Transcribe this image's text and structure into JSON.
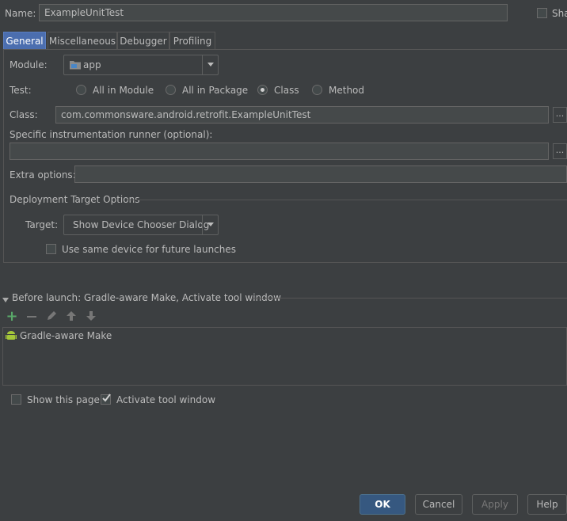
{
  "header": {
    "name_label": "Name:",
    "name_value": "ExampleUnitTest",
    "share_label": "Sha"
  },
  "tabs": [
    {
      "label": "General",
      "active": true
    },
    {
      "label": "Miscellaneous",
      "active": false
    },
    {
      "label": "Debugger",
      "active": false
    },
    {
      "label": "Profiling",
      "active": false
    }
  ],
  "general": {
    "module_label": "Module:",
    "module_value": "app",
    "test_label": "Test:",
    "test_options": [
      "All in Module",
      "All in Package",
      "Class",
      "Method"
    ],
    "test_selected": "Class",
    "class_label": "Class:",
    "class_value": "com.commonsware.android.retrofit.ExampleUnitTest",
    "runner_label": "Specific instrumentation runner (optional):",
    "runner_value": "",
    "extra_label": "Extra options:",
    "extra_value": "",
    "browse_label": "...",
    "deploy_section": "Deployment Target Options",
    "target_label": "Target:",
    "target_value": "Show Device Chooser Dialog",
    "same_device_label": "Use same device for future launches"
  },
  "before_launch": {
    "title": "Before launch: Gradle-aware Make, Activate tool window",
    "items": [
      "Gradle-aware Make"
    ]
  },
  "footer": {
    "show_page_label": "Show this page",
    "activate_label": "Activate tool window",
    "show_page_checked": false,
    "activate_checked": true
  },
  "buttons": {
    "ok": "OK",
    "cancel": "Cancel",
    "apply": "Apply",
    "help": "Help"
  },
  "colors": {
    "background": "#3c3f41",
    "text": "#bbbbbb",
    "accent_tab": "#4b6eaf",
    "primary_button": "#365880",
    "add_icon": "#59a869",
    "android_icon": "#a4c639"
  },
  "icons": [
    "folder-module-icon",
    "add-icon",
    "remove-icon",
    "edit-icon",
    "move-up-icon",
    "move-down-icon",
    "android-icon",
    "collapse-triangle-icon",
    "dropdown-arrow-icon"
  ]
}
